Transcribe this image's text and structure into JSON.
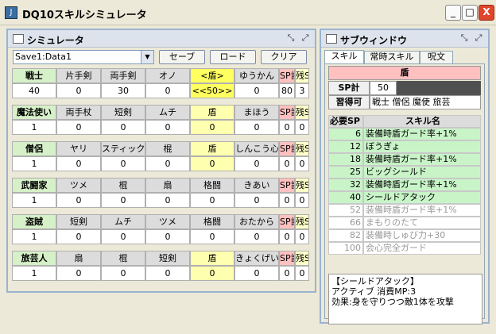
{
  "app": {
    "title": "DQ10スキルシミュレータ",
    "icon": "java-icon"
  },
  "window_controls": {
    "minimize": "_",
    "maximize": "□",
    "close": "X"
  },
  "simulator": {
    "title": "シミュレータ",
    "save_slot": "Save1:Data1",
    "buttons": {
      "save": "セーブ",
      "load": "ロード",
      "clear": "クリア"
    },
    "classes": [
      {
        "name": "戦士",
        "skills": [
          "片手剣",
          "両手剣",
          "オノ",
          "<盾>",
          "ゆうかん"
        ],
        "values": [
          "40",
          "0",
          "30",
          "0",
          "<<50>>",
          "0"
        ],
        "sp_total": "80",
        "sp_remain": "3",
        "selected_col": 3
      },
      {
        "name": "魔法使い",
        "skills": [
          "両手杖",
          "短剣",
          "ムチ",
          "盾",
          "まほう"
        ],
        "values": [
          "1",
          "0",
          "0",
          "0",
          "0",
          "0"
        ],
        "sp_total": "0",
        "sp_remain": "0",
        "selected_col": 3
      },
      {
        "name": "僧侶",
        "skills": [
          "ヤリ",
          "スティック",
          "棍",
          "盾",
          "しんこう心"
        ],
        "values": [
          "1",
          "0",
          "0",
          "0",
          "0",
          "0"
        ],
        "sp_total": "0",
        "sp_remain": "0",
        "selected_col": 3
      },
      {
        "name": "武闘家",
        "skills": [
          "ツメ",
          "棍",
          "扇",
          "格闘",
          "きあい"
        ],
        "values": [
          "1",
          "0",
          "0",
          "0",
          "0",
          "0"
        ],
        "sp_total": "0",
        "sp_remain": "0",
        "selected_col": -1
      },
      {
        "name": "盗賊",
        "skills": [
          "短剣",
          "ムチ",
          "ツメ",
          "格闘",
          "おたから"
        ],
        "values": [
          "1",
          "0",
          "0",
          "0",
          "0",
          "0"
        ],
        "sp_total": "0",
        "sp_remain": "0",
        "selected_col": -1
      },
      {
        "name": "旅芸人",
        "skills": [
          "扇",
          "棍",
          "短剣",
          "盾",
          "きょくげい"
        ],
        "values": [
          "1",
          "0",
          "0",
          "0",
          "0",
          "0"
        ],
        "sp_total": "0",
        "sp_remain": "0",
        "selected_col": 3
      }
    ],
    "sp_total_label": "SP計",
    "sp_remain_label": "残SP"
  },
  "subwindow": {
    "title": "サブウィンドウ",
    "tabs": [
      "スキル",
      "常時スキル",
      "呪文"
    ],
    "active_tab": 0,
    "skill_name": "盾",
    "sp_label": "SP計",
    "sp_value": "50",
    "learn_label": "習得可",
    "learn_value": "戦士 僧侶 魔使 旅芸",
    "table_headers": {
      "sp": "必要SP",
      "name": "スキル名"
    },
    "skills": [
      {
        "sp": "6",
        "name": "装備時盾ガード率+1%",
        "got": true
      },
      {
        "sp": "12",
        "name": "ぼうぎょ",
        "got": true
      },
      {
        "sp": "18",
        "name": "装備時盾ガード率+1%",
        "got": true
      },
      {
        "sp": "25",
        "name": "ビッグシールド",
        "got": true
      },
      {
        "sp": "32",
        "name": "装備時盾ガード率+1%",
        "got": true
      },
      {
        "sp": "40",
        "name": "シールドアタック",
        "got": true
      },
      {
        "sp": "52",
        "name": "装備時盾ガード率+1%",
        "got": false
      },
      {
        "sp": "66",
        "name": "まもりのたて",
        "got": false
      },
      {
        "sp": "82",
        "name": "装備時しゅび力+30",
        "got": false
      },
      {
        "sp": "100",
        "name": "会心完全ガード",
        "got": false
      }
    ],
    "description": [
      "【シールドアタック】",
      "アクティブ 消費MP:3",
      "効果:身を守りつつ敵1体を攻撃"
    ]
  }
}
